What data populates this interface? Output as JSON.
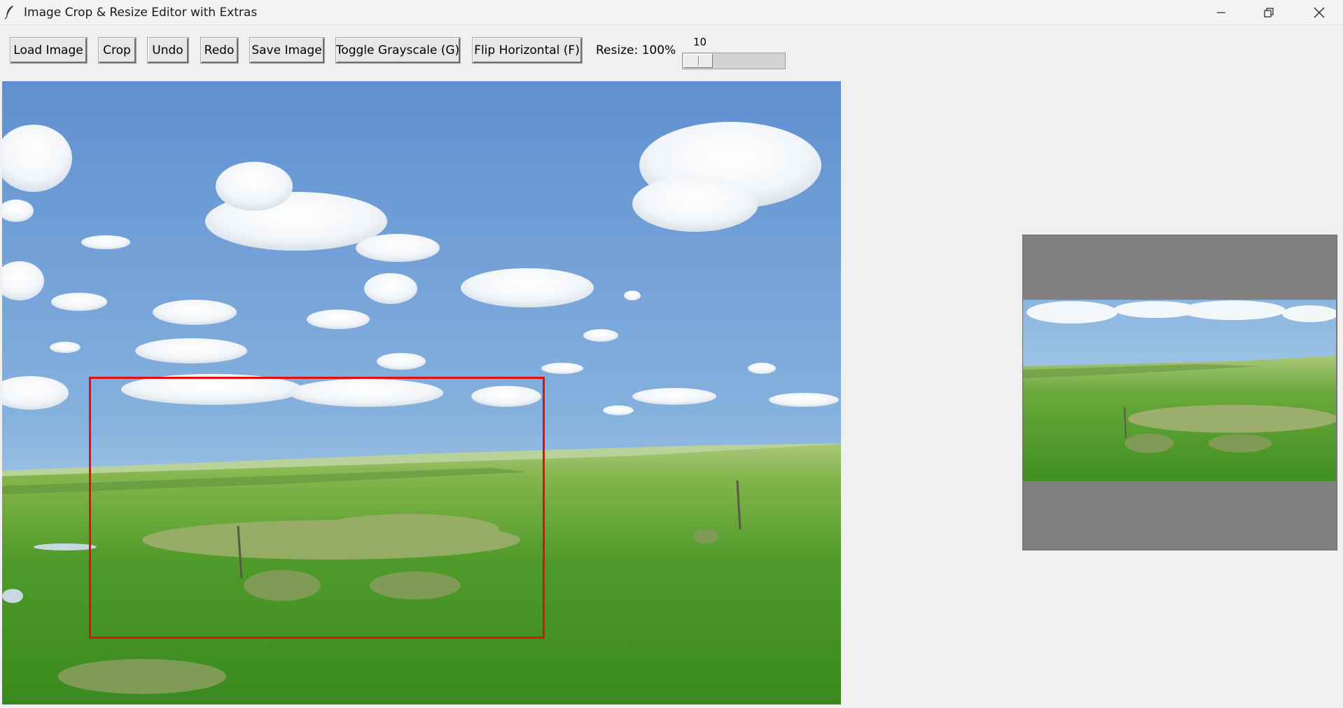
{
  "window": {
    "title": "Image Crop & Resize Editor with Extras",
    "icon": "feather-icon",
    "controls": [
      "minimize-icon",
      "restore-icon",
      "close-icon"
    ]
  },
  "toolbar": {
    "load_label": "Load Image",
    "crop_label": "Crop",
    "undo_label": "Undo",
    "redo_label": "Redo",
    "save_label": "Save Image",
    "grayscale_label": "Toggle Grayscale (G)",
    "flip_label": "Flip Horizontal (F)",
    "resize_label": "Resize: 100%",
    "scale": {
      "value": "10",
      "min": 10,
      "max": 200
    }
  },
  "canvas": {
    "content": "grassland-landscape-photo",
    "crop_color": "#e01010"
  },
  "preview": {
    "content": "cropped-landscape-preview",
    "background": "#808080"
  }
}
